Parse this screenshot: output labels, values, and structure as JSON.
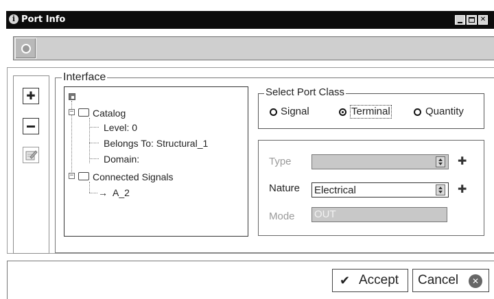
{
  "window": {
    "title": "Port Info",
    "icon": "info-icon",
    "controls": [
      "minimize-icon",
      "maximize-icon",
      "close-icon"
    ]
  },
  "toolbar": {
    "button_icon": "circle-icon"
  },
  "side_buttons": {
    "add_icon": "plus-icon",
    "remove_icon": "minus-icon",
    "edit_icon": "edit-document-icon"
  },
  "interface": {
    "legend": "Interface",
    "tree": {
      "catalog_label": "Catalog",
      "level": "Level: 0",
      "belongs_to": "Belongs To: Structural_1",
      "domain": "Domain:",
      "connected_label": "Connected Signals",
      "signal": "A_2",
      "signal_arrow": "→"
    }
  },
  "port_class": {
    "legend": "Select Port Class",
    "options": [
      "Signal",
      "Terminal",
      "Quantity"
    ],
    "selected": "Terminal"
  },
  "fields": {
    "type_label": "Type",
    "type_value": "",
    "nature_label": "Nature",
    "nature_value": "Electrical",
    "mode_label": "Mode",
    "mode_value": "OUT",
    "plus_symbol": "✚"
  },
  "dialog": {
    "accept_label": "Accept",
    "cancel_label": "Cancel",
    "accept_icon_glyph": "✔",
    "cancel_icon_glyph": "✕"
  },
  "colors": {
    "titlebar": "#0c0c0c",
    "toolbar": "#cfcfcf",
    "disabled_field": "#c8c8c8"
  }
}
